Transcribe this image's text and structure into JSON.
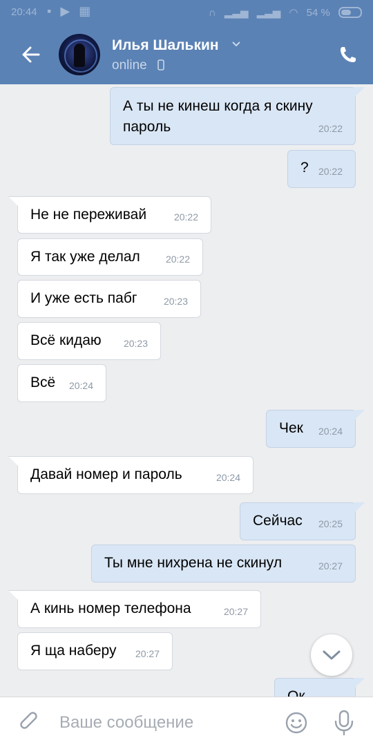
{
  "status_bar": {
    "time": "20:44",
    "battery_percent": "54 %"
  },
  "header": {
    "contact_name": "Илья Шалькин",
    "presence": "online"
  },
  "messages": [
    {
      "dir": "out",
      "text": "А ты не кинеш когда я скину\nпароль",
      "time": "20:22"
    },
    {
      "dir": "out",
      "text": "?",
      "time": "20:22"
    },
    {
      "dir": "in",
      "text": "Не не переживай",
      "time": "20:22"
    },
    {
      "dir": "in",
      "text": "Я так уже делал",
      "time": "20:22"
    },
    {
      "dir": "in",
      "text": "И уже есть пабг",
      "time": "20:23"
    },
    {
      "dir": "in",
      "text": "Всё кидаю",
      "time": "20:23"
    },
    {
      "dir": "in",
      "text": "Всё",
      "time": "20:24"
    },
    {
      "dir": "out",
      "text": "Чек",
      "time": "20:24"
    },
    {
      "dir": "in",
      "text": "Давай номер и пароль",
      "time": "20:24"
    },
    {
      "dir": "out",
      "text": "Сейчас",
      "time": "20:25"
    },
    {
      "dir": "out",
      "text": "Ты мне нихрена не скинул",
      "time": "20:27"
    },
    {
      "dir": "in",
      "text": "А кинь номер телефона",
      "time": "20:27"
    },
    {
      "dir": "in",
      "text": "Я ща наберу",
      "time": "20:27"
    },
    {
      "dir": "out",
      "text": "Ок",
      "time": ""
    }
  ],
  "composer": {
    "placeholder": "Ваше сообщение"
  },
  "colors": {
    "header": "#5b82b5",
    "outgoing_bubble": "#d9e6f5",
    "incoming_bubble": "#ffffff",
    "background": "#edeef0"
  }
}
